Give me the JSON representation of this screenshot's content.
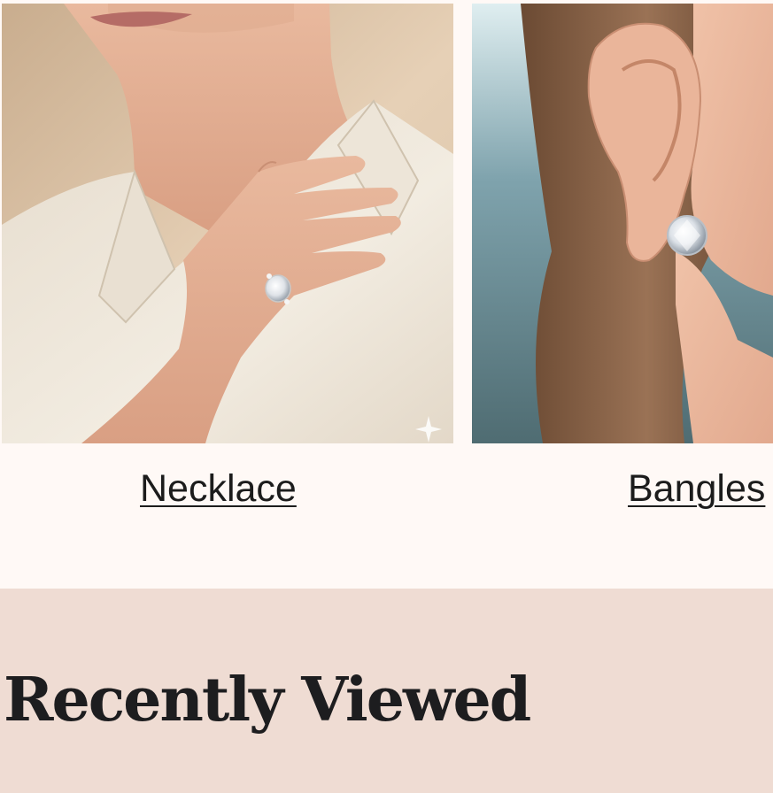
{
  "collections": {
    "items": [
      {
        "label": "Necklace",
        "image_alt": "Woman wearing a diamond solitaire ring with hand resting on her collar"
      },
      {
        "label": "Bangles",
        "image_alt": "Close-up of a diamond stud earring on an ear"
      }
    ]
  },
  "recently_viewed": {
    "title": "Recently Viewed"
  },
  "colors": {
    "page_bg": "#fff9f6",
    "section_bg": "#efdcd3",
    "text": "#1c1c1c"
  }
}
